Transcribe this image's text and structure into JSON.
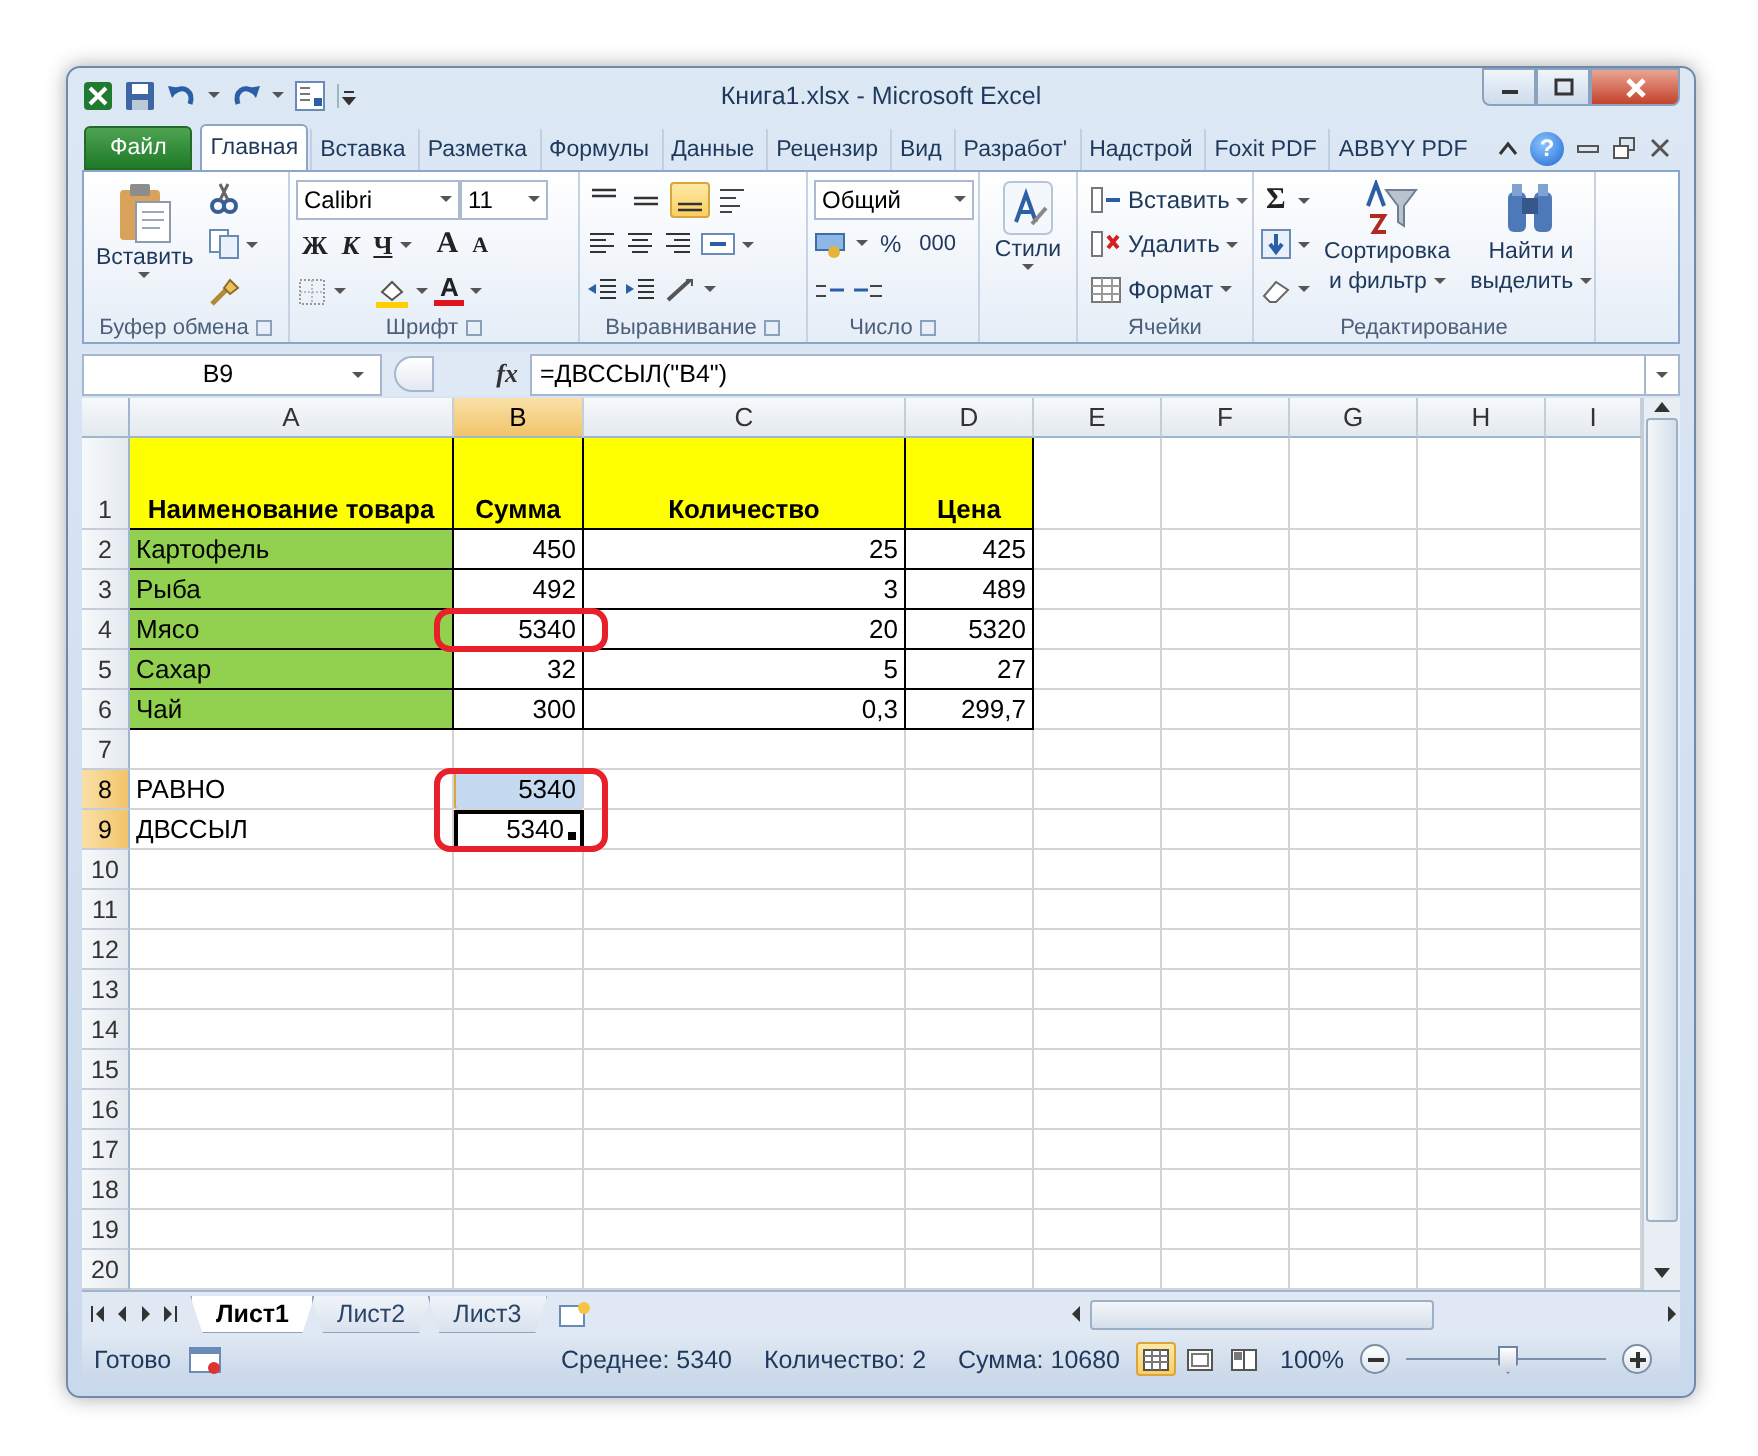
{
  "window": {
    "title": "Книга1.xlsx - Microsoft Excel"
  },
  "ribbon_tabs": [
    {
      "label": "Файл",
      "kind": "file",
      "selected": false
    },
    {
      "label": "Главная",
      "kind": "tab",
      "selected": true
    },
    {
      "label": "Вставка",
      "kind": "tab",
      "selected": false
    },
    {
      "label": "Разметка",
      "kind": "tab",
      "selected": false
    },
    {
      "label": "Формулы",
      "kind": "tab",
      "selected": false
    },
    {
      "label": "Данные",
      "kind": "tab",
      "selected": false
    },
    {
      "label": "Рецензир",
      "kind": "tab",
      "selected": false
    },
    {
      "label": "Вид",
      "kind": "tab",
      "selected": false
    },
    {
      "label": "Разработ'",
      "kind": "tab",
      "selected": false
    },
    {
      "label": "Надстрой",
      "kind": "tab",
      "selected": false
    },
    {
      "label": "Foxit PDF",
      "kind": "tab",
      "selected": false
    },
    {
      "label": "ABBYY PDF",
      "kind": "tab",
      "selected": false
    }
  ],
  "help_glyph": "?",
  "ribbon": {
    "clipboard": {
      "paste": "Вставить",
      "group": "Буфер обмена"
    },
    "font": {
      "name": "Calibri",
      "size": "11",
      "styles": [
        "Ж",
        "К",
        "Ч"
      ],
      "resize": [
        "A",
        "A"
      ],
      "color_letter": "A",
      "group": "Шрифт"
    },
    "alignment": {
      "vertical": [
        {
          "selected": false
        },
        {
          "selected": false
        },
        {
          "selected": true
        }
      ],
      "group": "Выравнивание"
    },
    "number": {
      "format": "Общий",
      "percent": "%",
      "thousands": "000",
      "group": "Число"
    },
    "styles": {
      "label": "Стили"
    },
    "cells": {
      "items": [
        "Вставить",
        "Удалить",
        "Формат"
      ],
      "group": "Ячейки"
    },
    "editing": {
      "sum": "Σ",
      "sort": [
        "Сортировка",
        "и фильтр"
      ],
      "find": [
        "Найти и",
        "выделить"
      ],
      "group": "Редактирование"
    }
  },
  "formula_bar": {
    "name_box": "B9",
    "function_label": "fx",
    "formula": "=ДВССЫЛ(\"B4\")"
  },
  "sheet": {
    "columns": [
      {
        "label": "A",
        "selected": false
      },
      {
        "label": "B",
        "selected": true
      },
      {
        "label": "C",
        "selected": false
      },
      {
        "label": "D",
        "selected": false
      },
      {
        "label": "E",
        "selected": false
      },
      {
        "label": "F",
        "selected": false
      },
      {
        "label": "G",
        "selected": false
      },
      {
        "label": "H",
        "selected": false
      },
      {
        "label": "I",
        "selected": false
      }
    ],
    "rows": [
      {
        "label": "1",
        "selected": false,
        "cells": [
          {
            "text": "Наименование товара",
            "kind": "header",
            "color": "#ffff00",
            "bordered": true,
            "selected": false,
            "active": false
          },
          {
            "text": "Сумма",
            "kind": "header",
            "color": "#ffff00",
            "bordered": true,
            "selected": false,
            "active": false
          },
          {
            "text": "Количество",
            "kind": "header",
            "color": "#ffff00",
            "bordered": true,
            "selected": false,
            "active": false
          },
          {
            "text": "Цена",
            "kind": "header",
            "color": "#ffff00",
            "bordered": true,
            "selected": false,
            "active": false
          }
        ]
      },
      {
        "label": "2",
        "selected": false,
        "cells": [
          {
            "text": "Картофель",
            "kind": "text",
            "color": "#92d050",
            "bordered": true,
            "selected": false,
            "active": false
          },
          {
            "text": "450",
            "kind": "number",
            "bordered": true,
            "selected": false,
            "active": false
          },
          {
            "text": "25",
            "kind": "number",
            "bordered": true,
            "selected": false,
            "active": false
          },
          {
            "text": "425",
            "kind": "number",
            "bordered": true,
            "selected": false,
            "active": false
          }
        ]
      },
      {
        "label": "3",
        "selected": false,
        "cells": [
          {
            "text": "Рыба",
            "kind": "text",
            "color": "#92d050",
            "bordered": true,
            "selected": false,
            "active": false
          },
          {
            "text": "492",
            "kind": "number",
            "bordered": true,
            "selected": false,
            "active": false
          },
          {
            "text": "3",
            "kind": "number",
            "bordered": true,
            "selected": false,
            "active": false
          },
          {
            "text": "489",
            "kind": "number",
            "bordered": true,
            "selected": false,
            "active": false
          }
        ]
      },
      {
        "label": "4",
        "selected": false,
        "cells": [
          {
            "text": "Мясо",
            "kind": "text",
            "color": "#92d050",
            "bordered": true,
            "selected": false,
            "active": false
          },
          {
            "text": "5340",
            "kind": "number",
            "bordered": true,
            "selected": false,
            "active": false,
            "circled": true
          },
          {
            "text": "20",
            "kind": "number",
            "bordered": true,
            "selected": false,
            "active": false
          },
          {
            "text": "5320",
            "kind": "number",
            "bordered": true,
            "selected": false,
            "active": false
          }
        ]
      },
      {
        "label": "5",
        "selected": false,
        "cells": [
          {
            "text": "Сахар",
            "kind": "text",
            "color": "#92d050",
            "bordered": true,
            "selected": false,
            "active": false
          },
          {
            "text": "32",
            "kind": "number",
            "bordered": true,
            "selected": false,
            "active": false
          },
          {
            "text": "5",
            "kind": "number",
            "bordered": true,
            "selected": false,
            "active": false
          },
          {
            "text": "27",
            "kind": "number",
            "bordered": true,
            "selected": false,
            "active": false
          }
        ]
      },
      {
        "label": "6",
        "selected": false,
        "cells": [
          {
            "text": "Чай",
            "kind": "text",
            "color": "#92d050",
            "bordered": true,
            "selected": false,
            "active": false
          },
          {
            "text": "300",
            "kind": "number",
            "bordered": true,
            "selected": false,
            "active": false
          },
          {
            "text": "0,3",
            "kind": "number",
            "bordered": true,
            "selected": false,
            "active": false
          },
          {
            "text": "299,7",
            "kind": "number",
            "bordered": true,
            "selected": false,
            "active": false
          }
        ]
      },
      {
        "label": "7",
        "selected": false
      },
      {
        "label": "8",
        "selected": true,
        "cells": [
          {
            "text": "РАВНО",
            "kind": "text",
            "bordered": false,
            "selected": false,
            "active": false
          },
          {
            "text": "5340",
            "kind": "number",
            "bordered": false,
            "selected": true,
            "active": false,
            "circled": true
          }
        ]
      },
      {
        "label": "9",
        "selected": true,
        "cells": [
          {
            "text": "ДВССЫЛ",
            "kind": "text",
            "bordered": false,
            "selected": false,
            "active": false
          },
          {
            "text": "5340",
            "kind": "number",
            "bordered": false,
            "selected": true,
            "active": true,
            "circled": true
          }
        ]
      },
      {
        "label": "10",
        "selected": false
      },
      {
        "label": "11",
        "selected": false
      },
      {
        "label": "12",
        "selected": false
      },
      {
        "label": "13",
        "selected": false
      },
      {
        "label": "14",
        "selected": false
      },
      {
        "label": "15",
        "selected": false
      },
      {
        "label": "16",
        "selected": false
      },
      {
        "label": "17",
        "selected": false
      },
      {
        "label": "18",
        "selected": false
      },
      {
        "label": "19",
        "selected": false
      },
      {
        "label": "20",
        "selected": false
      }
    ]
  },
  "sheet_tabs": [
    {
      "label": "Лист1",
      "selected": true
    },
    {
      "label": "Лист2",
      "selected": false
    },
    {
      "label": "Лист3",
      "selected": false
    }
  ],
  "status_bar": {
    "ready": "Готово",
    "average": "Среднее: 5340",
    "count": "Количество: 2",
    "sum": "Сумма: 10680",
    "views": [
      {
        "selected": true
      },
      {
        "selected": false
      },
      {
        "selected": false
      }
    ],
    "zoom": "100%",
    "zoom_slider": {
      "level": 0.5
    }
  }
}
